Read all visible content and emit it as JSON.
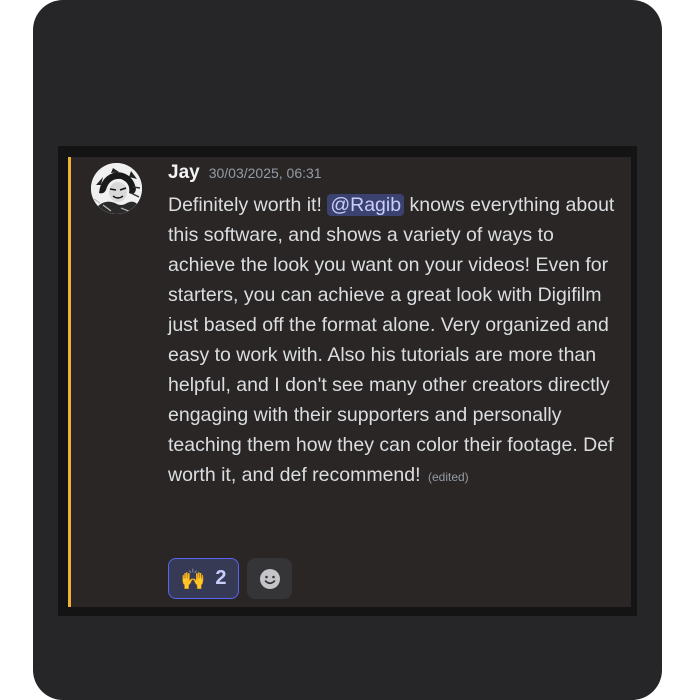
{
  "message": {
    "author": "Jay",
    "timestamp": "30/03/2025, 06:31",
    "text_before_mention": "Definitely worth it! ",
    "mention": "@Ragib",
    "text_after_mention": " knows everything about this software, and shows a variety of ways to achieve the look you want on your videos! Even for starters, you can achieve a great look with Digifilm just based off the format alone. Very organized and easy to work with. Also his tutorials are more than helpful, and I don't see many other creators directly engaging with their supporters and personally teaching them how they can color their footage. Def worth it, and def recommend!",
    "edited_label": "(edited)",
    "avatar_icon": "manga-avatar-icon"
  },
  "reactions": [
    {
      "emoji": "🙌",
      "emoji_name": "raising-hands-icon",
      "count": "2",
      "active": true
    }
  ],
  "add_reaction": {
    "icon": "smiley-add-reaction-icon"
  },
  "colors": {
    "accent_bar": "#f0b232",
    "mention_bg": "#3c4270",
    "mention_text": "#c9cdfb",
    "reaction_border": "#5865f2",
    "message_bg": "#2a2625"
  }
}
